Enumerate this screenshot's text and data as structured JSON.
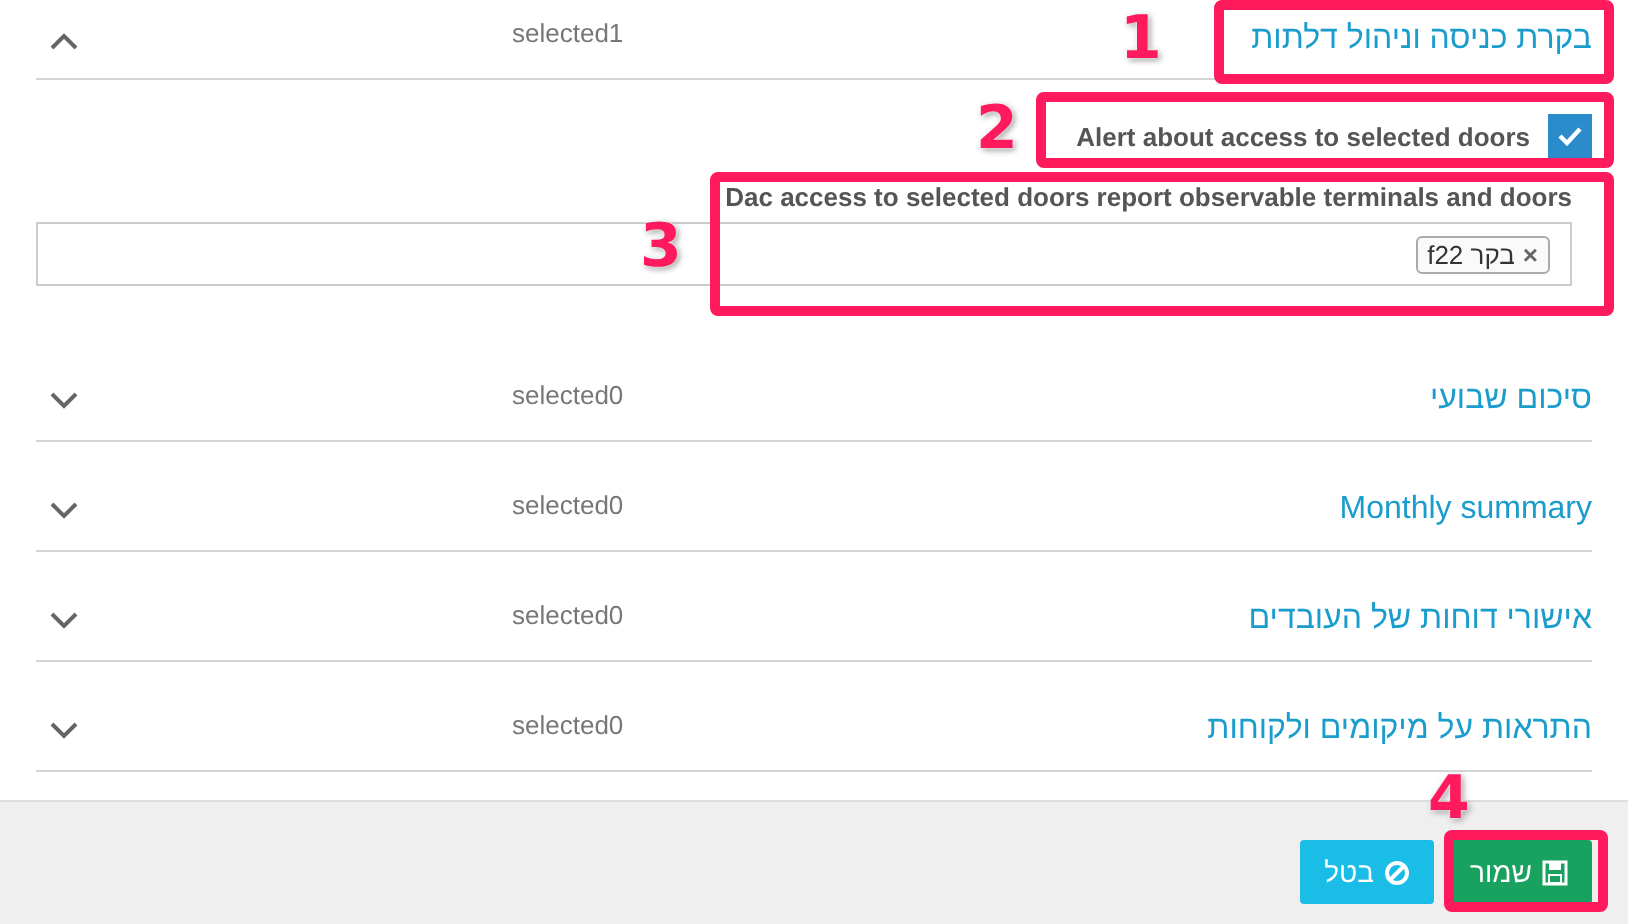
{
  "sections": [
    {
      "title": "בקרת כניסה וניהול דלתות",
      "count": "selected1",
      "expanded": true,
      "options": [
        {
          "kind": "checkbox",
          "label": "Alert about access to selected doors",
          "checked": true
        },
        {
          "kind": "multiselect",
          "label": "Dac access to selected doors report observable terminals and doors",
          "tags": [
            {
              "remove": "×",
              "text": "בקר f22"
            }
          ]
        }
      ]
    },
    {
      "title": "סיכום שבועי",
      "count": "selected0",
      "expanded": false
    },
    {
      "title": "Monthly summary",
      "count": "selected0",
      "expanded": false
    },
    {
      "title": "אישורי דוחות של העובדים",
      "count": "selected0",
      "expanded": false
    },
    {
      "title": "התראות על מיקומים ולקוחות",
      "count": "selected0",
      "expanded": false
    }
  ],
  "footer": {
    "buttons": [
      {
        "kind": "save",
        "label": "שמור"
      },
      {
        "kind": "cancel",
        "label": "בטל"
      }
    ]
  },
  "annotations": [
    {
      "label": "1"
    },
    {
      "label": "2"
    },
    {
      "label": "3"
    },
    {
      "label": "4"
    }
  ]
}
